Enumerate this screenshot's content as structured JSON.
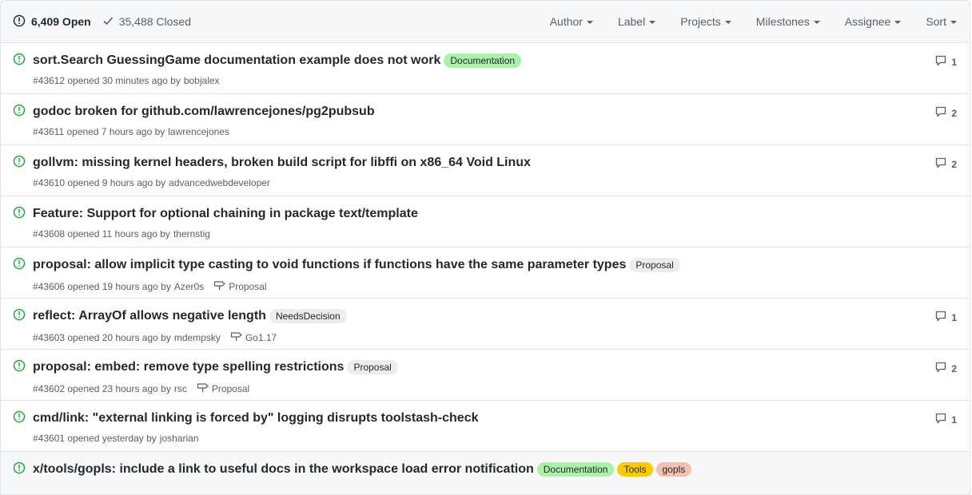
{
  "header": {
    "open_label": "6,409 Open",
    "closed_label": "35,488 Closed",
    "filters": [
      "Author",
      "Label",
      "Projects",
      "Milestones",
      "Assignee",
      "Sort"
    ]
  },
  "issues": [
    {
      "title": "sort.Search GuessingGame documentation example does not work",
      "meta": "#43612 opened 30 minutes ago by",
      "author": "bobjalex",
      "labels": [
        {
          "name": "Documentation",
          "color": "#aaf0a8"
        }
      ],
      "milestone": "",
      "comments": "1"
    },
    {
      "title": "godoc broken for github.com/lawrencejones/pg2pubsub",
      "meta": "#43611 opened 7 hours ago by",
      "author": "lawrencejones",
      "labels": [],
      "milestone": "",
      "comments": "2"
    },
    {
      "title": "gollvm: missing kernel headers, broken build script for libffi on x86_64 Void Linux",
      "meta": "#43610 opened 9 hours ago by",
      "author": "advancedwebdeveloper",
      "labels": [],
      "milestone": "",
      "comments": "2"
    },
    {
      "title": "Feature: Support for optional chaining in package text/template",
      "meta": "#43608 opened 11 hours ago by",
      "author": "thernstig",
      "labels": [],
      "milestone": "",
      "comments": ""
    },
    {
      "title": "proposal: allow implicit type casting to void functions if functions have the same parameter types",
      "meta": "#43606 opened 19 hours ago by",
      "author": "Azer0s",
      "labels": [
        {
          "name": "Proposal",
          "color": "#ededed"
        }
      ],
      "milestone": "Proposal",
      "comments": ""
    },
    {
      "title": "reflect: ArrayOf allows negative length",
      "meta": "#43603 opened 20 hours ago by",
      "author": "mdempsky",
      "labels": [
        {
          "name": "NeedsDecision",
          "color": "#ededed"
        }
      ],
      "milestone": "Go1.17",
      "comments": "1"
    },
    {
      "title": "proposal: embed: remove type spelling restrictions",
      "meta": "#43602 opened 23 hours ago by",
      "author": "rsc",
      "labels": [
        {
          "name": "Proposal",
          "color": "#ededed"
        }
      ],
      "milestone": "Proposal",
      "comments": "2"
    },
    {
      "title": "cmd/link: \"external linking is forced by\" logging disrupts toolstash-check",
      "meta": "#43601 opened yesterday by",
      "author": "josharian",
      "labels": [],
      "milestone": "",
      "comments": "1"
    },
    {
      "title": "x/tools/gopls: include a link to useful docs in the workspace load error notification",
      "meta": "",
      "author": "",
      "labels": [
        {
          "name": "Documentation",
          "color": "#aaf0a8"
        },
        {
          "name": "Tools",
          "color": "#fbca04"
        },
        {
          "name": "gopls",
          "color": "#f2c0b0"
        }
      ],
      "milestone": "",
      "comments": ""
    }
  ],
  "colors": {
    "open_green": "#28a745",
    "muted": "#586069",
    "border": "#e1e4e8"
  },
  "icons": {
    "open_state": "issue-opened-icon",
    "closed_state": "check-icon",
    "comment": "comment-icon",
    "milestone": "milestone-icon"
  }
}
